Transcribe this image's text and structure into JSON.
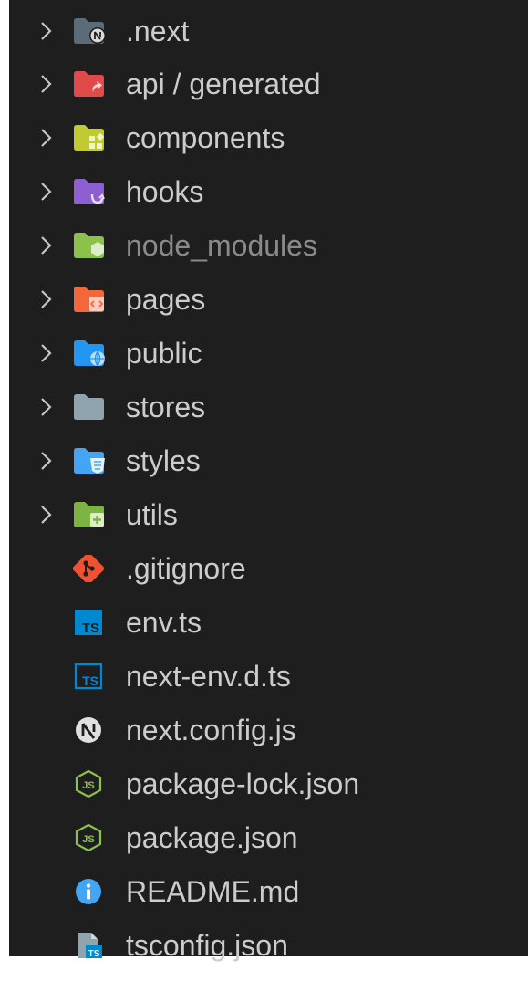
{
  "explorer": {
    "items": [
      {
        "kind": "folder",
        "label": ".next",
        "icon": "folder-next-icon",
        "dim": true,
        "color": "#5b6b78"
      },
      {
        "kind": "folder",
        "label": "api / generated",
        "icon": "folder-api-icon",
        "dim": false,
        "color": "#e04a4a"
      },
      {
        "kind": "folder",
        "label": "components",
        "icon": "folder-components-icon",
        "dim": false,
        "color": "#c0ca33"
      },
      {
        "kind": "folder",
        "label": "hooks",
        "icon": "folder-hooks-icon",
        "dim": false,
        "color": "#8e5fd0"
      },
      {
        "kind": "folder",
        "label": "node_modules",
        "icon": "folder-node-icon",
        "dim": true,
        "color": "#8bc34a"
      },
      {
        "kind": "folder",
        "label": "pages",
        "icon": "folder-pages-icon",
        "dim": false,
        "color": "#f4673b"
      },
      {
        "kind": "folder",
        "label": "public",
        "icon": "folder-public-icon",
        "dim": false,
        "color": "#2196f3"
      },
      {
        "kind": "folder",
        "label": "stores",
        "icon": "folder-stores-icon",
        "dim": false,
        "color": "#90a4ae"
      },
      {
        "kind": "folder",
        "label": "styles",
        "icon": "folder-styles-icon",
        "dim": false,
        "color": "#42a5f5"
      },
      {
        "kind": "folder",
        "label": "utils",
        "icon": "folder-utils-icon",
        "dim": false,
        "color": "#7cb342"
      },
      {
        "kind": "file",
        "label": ".gitignore",
        "icon": "git-icon",
        "dim": false,
        "color": "#f05133"
      },
      {
        "kind": "file",
        "label": "env.ts",
        "icon": "typescript-icon",
        "dim": false,
        "color": "#0288d1"
      },
      {
        "kind": "file",
        "label": "next-env.d.ts",
        "icon": "typescript-def-icon",
        "dim": false,
        "color": "#0288d1"
      },
      {
        "kind": "file",
        "label": "next.config.js",
        "icon": "next-icon",
        "dim": false,
        "color": "#e0e0e0"
      },
      {
        "kind": "file",
        "label": "package-lock.json",
        "icon": "nodejs-icon",
        "dim": false,
        "color": "#8bc34a"
      },
      {
        "kind": "file",
        "label": "package.json",
        "icon": "nodejs-icon",
        "dim": false,
        "color": "#8bc34a"
      },
      {
        "kind": "file",
        "label": "README.md",
        "icon": "info-icon",
        "dim": false,
        "color": "#42a5f5"
      },
      {
        "kind": "file",
        "label": "tsconfig.json",
        "icon": "tsconfig-icon",
        "dim": false,
        "color": "#90a4ae"
      }
    ]
  }
}
